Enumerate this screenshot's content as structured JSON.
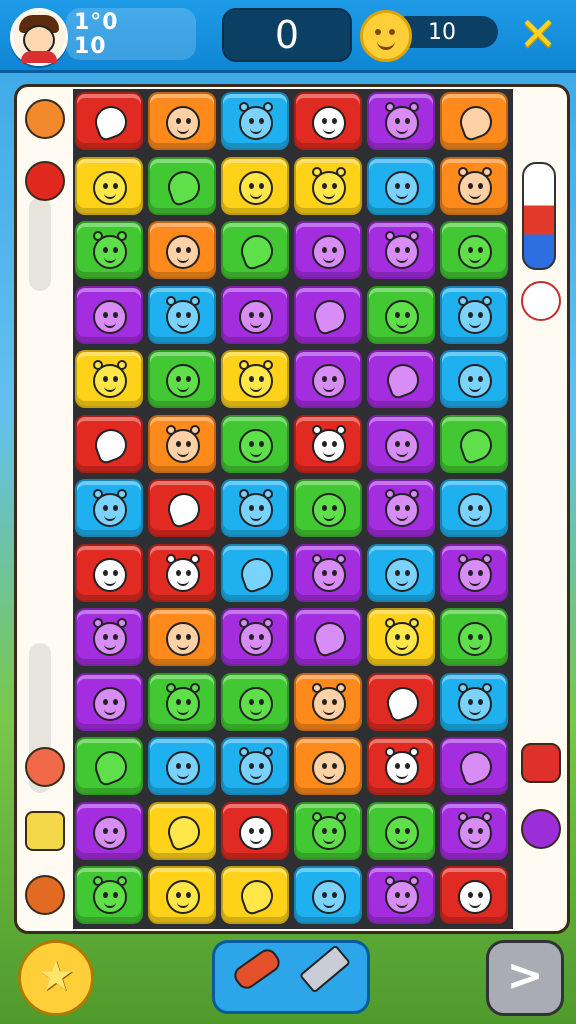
{
  "header": {
    "stat_primary": "1°0",
    "stat_secondary": "10",
    "score_value": "0",
    "coins_value": "10",
    "close_symbol": "✕"
  },
  "board": {
    "rows": 13,
    "cols": 6,
    "tiles": [
      [
        "red",
        "orange",
        "blue",
        "red",
        "purple",
        "orange"
      ],
      [
        "yellow",
        "green",
        "yellow",
        "yellow",
        "blue",
        "orange"
      ],
      [
        "green",
        "orange",
        "green",
        "purple",
        "purple",
        "green"
      ],
      [
        "purple",
        "blue",
        "purple",
        "purple",
        "green",
        "blue"
      ],
      [
        "yellow",
        "green",
        "yellow",
        "purple",
        "purple",
        "blue"
      ],
      [
        "red",
        "orange",
        "green",
        "red",
        "purple",
        "green"
      ],
      [
        "blue",
        "red",
        "blue",
        "green",
        "purple",
        "blue"
      ],
      [
        "red",
        "red",
        "blue",
        "purple",
        "blue",
        "purple"
      ],
      [
        "purple",
        "orange",
        "purple",
        "purple",
        "yellow",
        "green"
      ],
      [
        "purple",
        "green",
        "green",
        "orange",
        "red",
        "blue"
      ],
      [
        "green",
        "blue",
        "blue",
        "orange",
        "red",
        "purple"
      ],
      [
        "purple",
        "yellow",
        "red",
        "green",
        "green",
        "purple"
      ],
      [
        "green",
        "yellow",
        "yellow",
        "blue",
        "purple",
        "red"
      ]
    ],
    "left_icons": [
      "basketball-icon",
      "apple-icon",
      "peach-icon",
      "pencil-icon",
      "leaf-icon"
    ],
    "right_icons": [
      "thermometer-icon",
      "no-entry-icon",
      "drum-icon",
      "grape-icon"
    ]
  },
  "colors": {
    "red": "#e02a22",
    "orange": "#ff8a1c",
    "yellow": "#ffd21a",
    "green": "#42c832",
    "blue": "#1fb0ef",
    "purple": "#a52de0",
    "board_bg": "#fffbf2",
    "accent": "#0f86d4"
  },
  "footer": {
    "star_symbol": "★",
    "next_symbol": ">"
  }
}
